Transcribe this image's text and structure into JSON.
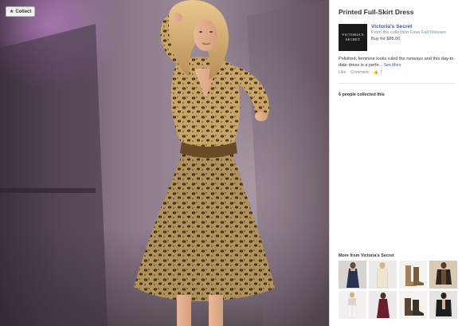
{
  "viewer": {
    "collect_label": "Collect",
    "collect_icon": "star-icon"
  },
  "product": {
    "title": "Printed Full-Skirt Dress",
    "brand": {
      "name": "Victoria's Secret",
      "logo_text": "VICTORIA'S SECRET",
      "collection_prefix": "From the collection",
      "collection_name": "Fave Fall Dresses",
      "price": "Buy for $88.00"
    },
    "description": "Polished, feminine looks ruled the runways and this day-to-date dress is a perfe...",
    "see_more": "See More",
    "actions": {
      "like": "Like",
      "comment": "Comment",
      "like_count": "7"
    }
  },
  "collected_text": "6 people collected this",
  "more_from": {
    "label": "More from Victoria's Secret",
    "items": [
      "navy-dress-thumbnail",
      "cream-sweater-dress-thumbnail",
      "tan-boots-thumbnail",
      "leather-jacket-thumbnail",
      "white-pants-thumbnail",
      "burgundy-dress-thumbnail",
      "brown-ankle-boots-thumbnail",
      "black-jacket-thumbnail"
    ]
  },
  "colors": {
    "link": "#3b5998",
    "link_light": "#6d84b4",
    "dress_base": "#c9a86a",
    "background_purple": "#8a7488"
  }
}
